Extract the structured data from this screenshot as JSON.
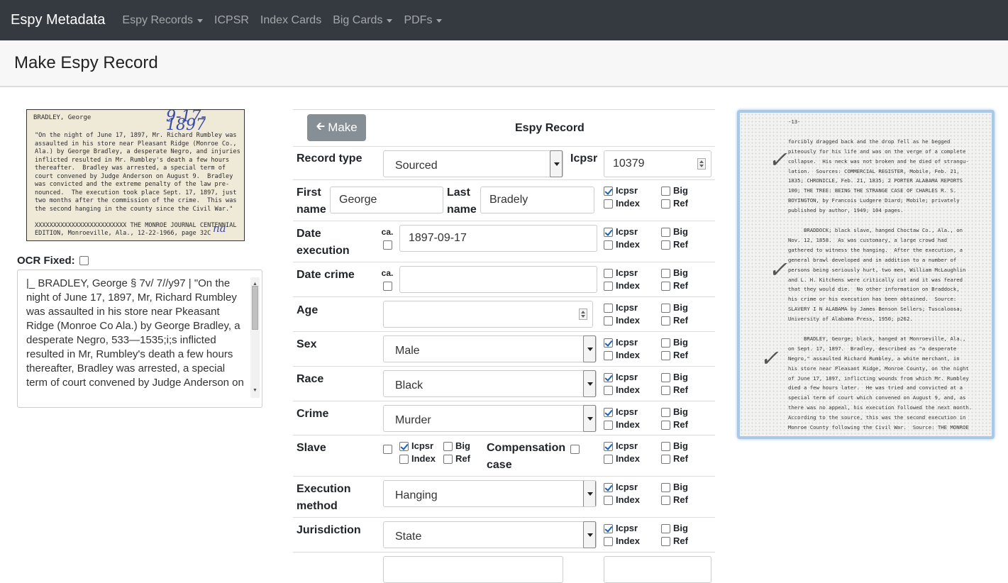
{
  "navbar": {
    "brand": "Espy Metadata",
    "items": [
      {
        "label": "Espy Records",
        "dropdown": true
      },
      {
        "label": "ICPSR",
        "dropdown": false
      },
      {
        "label": "Index Cards",
        "dropdown": false
      },
      {
        "label": "Big Cards",
        "dropdown": true
      },
      {
        "label": "PDFs",
        "dropdown": true
      }
    ]
  },
  "page": {
    "title": "Make Espy Record"
  },
  "index_card": {
    "name": "BRADLEY, George",
    "handwritten_date": "9-17-1897",
    "text": "\"On the night of June 17, 1897, Mr. Richard Rumbley was\nassaulted in his store near Pleasant Ridge (Monroe Co.,\nAla.) by George Bradley, a desperate Negro, and injuries\ninflicted resulted in Mr. Rumbley's death a few hours\nthereafter.  Bradley was arrested, a special term of\ncourt convened by Judge Anderson on August 9.  Bradley\nwas convicted and the extreme penalty of the law pre-\nnounced.  The execution took place Sept. 17, 1897, just\ntwo months after the commission of the crime.  This was\nthe second hanging in the county since the Civil War.\"\n\nXXXXXXXXXXXXXXXXXXXXXXXXX THE MONROE JOURNAL CENTENNIAL\nEDITION, Monroeville, Ala., 12-22-1966, page 32C",
    "initials": "na"
  },
  "ocr": {
    "label": "OCR Fixed:",
    "fixed": false,
    "text": "|_ BRADLEY, George § 7v/ 7//y97  | \"On the night of June 17, 1897, Mr, Richard Rumbley was assaulted in his store near Pkeasant Ridge (Monroe Co Ala.) by George Bradley, a desperate Negro, 533—1535;i;s inflicted resulted in Mr, Rumbley's death a few hours thereafter, Bradley was arrested, a special term of court convened by Judge Anderson on"
  },
  "form": {
    "make_button": "Make",
    "title": "Espy Record",
    "record_type": {
      "label": "Record type",
      "value": "Sourced"
    },
    "icpsr": {
      "label": "Icpsr",
      "value": "10379"
    },
    "first_name": {
      "label_1": "First",
      "label_2": "name",
      "value": "George"
    },
    "last_name": {
      "label_1": "Last",
      "label_2": "name",
      "value": "Bradely"
    },
    "date_execution": {
      "label_1": "Date",
      "label_2": "execution",
      "ca_label": "ca.",
      "ca": false,
      "value": "1897-09-17"
    },
    "date_crime": {
      "label": "Date crime",
      "ca_label": "ca.",
      "ca": false,
      "value": ""
    },
    "age": {
      "label": "Age",
      "value": ""
    },
    "sex": {
      "label": "Sex",
      "value": "Male"
    },
    "race": {
      "label": "Race",
      "value": "Black"
    },
    "crime": {
      "label": "Crime",
      "value": "Murder"
    },
    "slave": {
      "label": "Slave",
      "value": false
    },
    "compensation": {
      "label_1": "Compensation",
      "label_2": "case",
      "value": false
    },
    "execution_method": {
      "label_1": "Execution",
      "label_2": "method",
      "value": "Hanging"
    },
    "jurisdiction": {
      "label": "Jurisdiction",
      "value": "State"
    },
    "flag_labels": {
      "icpsr": "Icpsr",
      "big": "Big",
      "index": "Index",
      "ref": "Ref"
    }
  },
  "scan": {
    "text": "-13-\n\nforcibly dragged back and the drop fell as he begged\npiteously for his life and was on the verge of a complete\ncollapse.  His neck was not broken and he died of strangu-\nlation.  Sources: COMMERCIAL REGISTER, Mobile, Feb. 21,\n1835; CHRONICLE, Feb. 21, 1835; 2 PORTER ALABAMA REPORTS\n100; THE TREE: BEING THE STRANGE CASE OF CHARLES R. S.\nBOYINGTON, by Francois Ludgere Diard; Mobile; privately\npublished by author, 1949; 104 pages.\n\n     BRADDOCK; black slave, hanged Choctaw Co., Ala., on\nNov. 12, 1858.  As was customary, a large crowd had\ngathered to witness the hanging.  After the execution, a\ngeneral brawl developed and in addition to a number of\npersons being seriously hurt, two men, William McLaughlin\nand L. H. Kitchens were critically cut and it was feared\nthat they would die.  No other information on Braddock,\nhis crime or his execution has been obtained.  Source:\nSLAVERY I N ALABAMA by James Benson Sellers; Tuscaloosa;\nUniversity of Alabama Press, 1950; p262.\n\n     BRADLEY, George; black, hanged at Monroeville, Ala.,\non Sept. 17, 1897.  Bradley, described as \"a desperate\nNegro,\" assaulted Richard Rumbley, a white merchant, in\nhis store near Pleasant Ridge, Monroe County, on the night\nof June 17, 1897, inflicting wounds from which Mr. Rumbley\ndied a few hours later.  He was tried and convicted at a\nspecial term of court which convened on August 9, and, as\nthere was no appeal, his execution followed the next month.\nAccording to the source, this was the second execution in\nMonroe County following the Civil War.  Source: THE MONROE"
  }
}
